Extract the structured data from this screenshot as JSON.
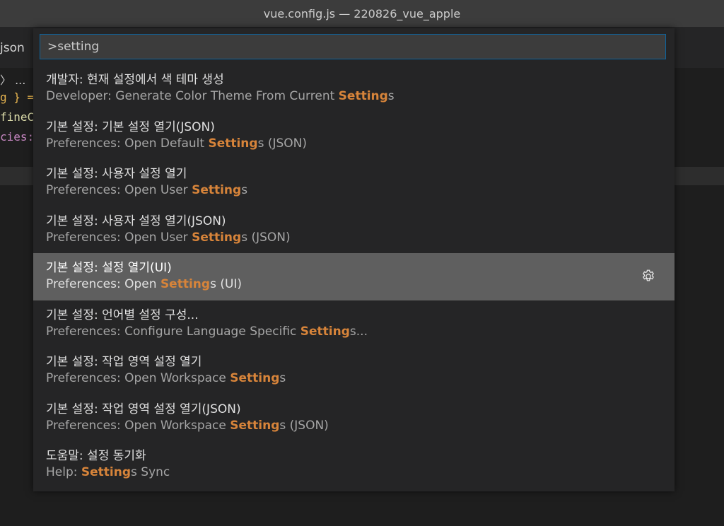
{
  "window": {
    "title": "vue.config.js — 220826_vue_apple"
  },
  "editor": {
    "tab_fragment": "json",
    "breadcrumb_fragment": "〉 ...",
    "code_lines": [
      "g } =",
      "fineC",
      "cies:"
    ]
  },
  "command_palette": {
    "input_value": ">setting",
    "items": [
      {
        "label": "개발자: 현재 설정에서 색 테마 생성",
        "detail_before": "Developer: Generate Color Theme From Current ",
        "detail_highlight": "Setting",
        "detail_after": "s"
      },
      {
        "label": "기본 설정: 기본 설정 열기(JSON)",
        "detail_before": "Preferences: Open Default ",
        "detail_highlight": "Setting",
        "detail_after": "s (JSON)"
      },
      {
        "label": "기본 설정: 사용자 설정 열기",
        "detail_before": "Preferences: Open User ",
        "detail_highlight": "Setting",
        "detail_after": "s"
      },
      {
        "label": "기본 설정: 사용자 설정 열기(JSON)",
        "detail_before": "Preferences: Open User ",
        "detail_highlight": "Setting",
        "detail_after": "s (JSON)"
      },
      {
        "label": "기본 설정: 설정 열기(UI)",
        "detail_before": "Preferences: Open ",
        "detail_highlight": "Setting",
        "detail_after": "s (UI)",
        "selected": true
      },
      {
        "label": "기본 설정: 언어별 설정 구성...",
        "detail_before": "Preferences: Configure Language Specific ",
        "detail_highlight": "Setting",
        "detail_after": "s..."
      },
      {
        "label": "기본 설정: 작업 영역 설정 열기",
        "detail_before": "Preferences: Open Workspace ",
        "detail_highlight": "Setting",
        "detail_after": "s"
      },
      {
        "label": "기본 설정: 작업 영역 설정 열기(JSON)",
        "detail_before": "Preferences: Open Workspace ",
        "detail_highlight": "Setting",
        "detail_after": "s (JSON)"
      },
      {
        "label": "도움말: 설정 동기화",
        "detail_before": "Help: ",
        "detail_highlight": "Setting",
        "detail_after": "s Sync"
      }
    ],
    "gear_icon": "gear-icon"
  },
  "colors": {
    "highlight": "#d7843a",
    "selected_bg": "#5f5f5f",
    "focus_border": "#0e639c"
  }
}
